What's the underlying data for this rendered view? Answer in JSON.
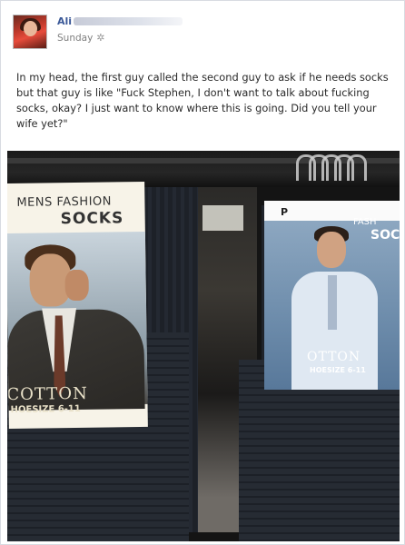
{
  "post": {
    "author_name": "Ali",
    "timestamp": "Sunday",
    "audience_icon": "friends-icon",
    "caption": "In my head, the first guy called the second guy to ask if he needs socks but that guy is like \"Fuck Stephen, I don't want to talk about fucking socks, okay? I just want to know where this is going. Did you tell your wife yet?\""
  },
  "photo": {
    "left_card": {
      "line1": "MENS FASHION",
      "line2": "SOCKS",
      "bottom_brand": "COTTON",
      "bottom_size": "HOESIZE 6-11"
    },
    "right_card": {
      "logo": "P",
      "line1": "FASH",
      "line2": "SOC",
      "bottom_brand": "OTTON",
      "bottom_size": "HOESIZE 6-11"
    }
  },
  "colors": {
    "link": "#3b5998",
    "meta": "#7f7f7f",
    "text": "#2a2a2a"
  }
}
